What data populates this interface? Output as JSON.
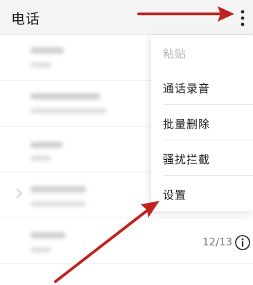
{
  "header": {
    "title": "电话",
    "more_icon": "more-vertical-icon"
  },
  "menu": {
    "items": [
      {
        "label": "粘贴",
        "enabled": false
      },
      {
        "label": "通话录音",
        "enabled": true
      },
      {
        "label": "批量删除",
        "enabled": true
      },
      {
        "label": "骚扰拦截",
        "enabled": true
      },
      {
        "label": "设置",
        "enabled": true
      }
    ]
  },
  "call_log": {
    "last_row": {
      "date": "12/13",
      "info_icon": "info-icon"
    }
  },
  "annotation": {
    "arrow_color": "#c0221f"
  }
}
